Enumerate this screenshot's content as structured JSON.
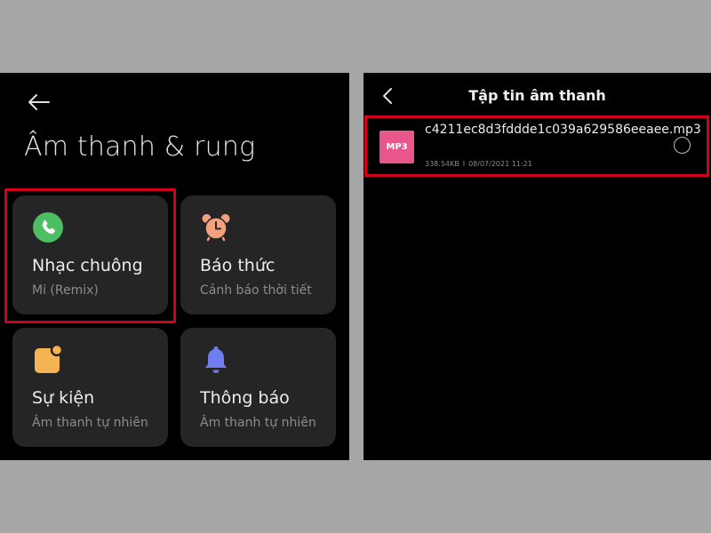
{
  "left": {
    "title": "Âm thanh & rung",
    "tiles": [
      {
        "title": "Nhạc chuông",
        "subtitle": "Mi (Remix)",
        "icon": "phone-icon",
        "color": "#4cbe63"
      },
      {
        "title": "Báo thức",
        "subtitle": "Cảnh báo thời tiết",
        "icon": "alarm-clock-icon",
        "color": "#f3a07e"
      },
      {
        "title": "Sự kiện",
        "subtitle": "Âm thanh tự nhiên",
        "icon": "calendar-event-icon",
        "color": "#f4b454"
      },
      {
        "title": "Thông báo",
        "subtitle": "Âm thanh tự nhiên",
        "icon": "bell-icon",
        "color": "#6f7ef0"
      }
    ],
    "highlighted_tile": "Nhạc chuông"
  },
  "right": {
    "title": "Tập tin âm thanh",
    "file": {
      "badge": "MP3",
      "name": "c4211ec8d3fddde1c039a629586eeaee.mp3",
      "size": "338.54KB",
      "separator": "I",
      "date": "08/07/2021 11:21",
      "selected": false
    }
  },
  "colors": {
    "background": "#a6a6a6",
    "panel": "#000000",
    "tile": "#252525",
    "highlight": "#d0021b",
    "mp3_badge": "#e8568c"
  }
}
